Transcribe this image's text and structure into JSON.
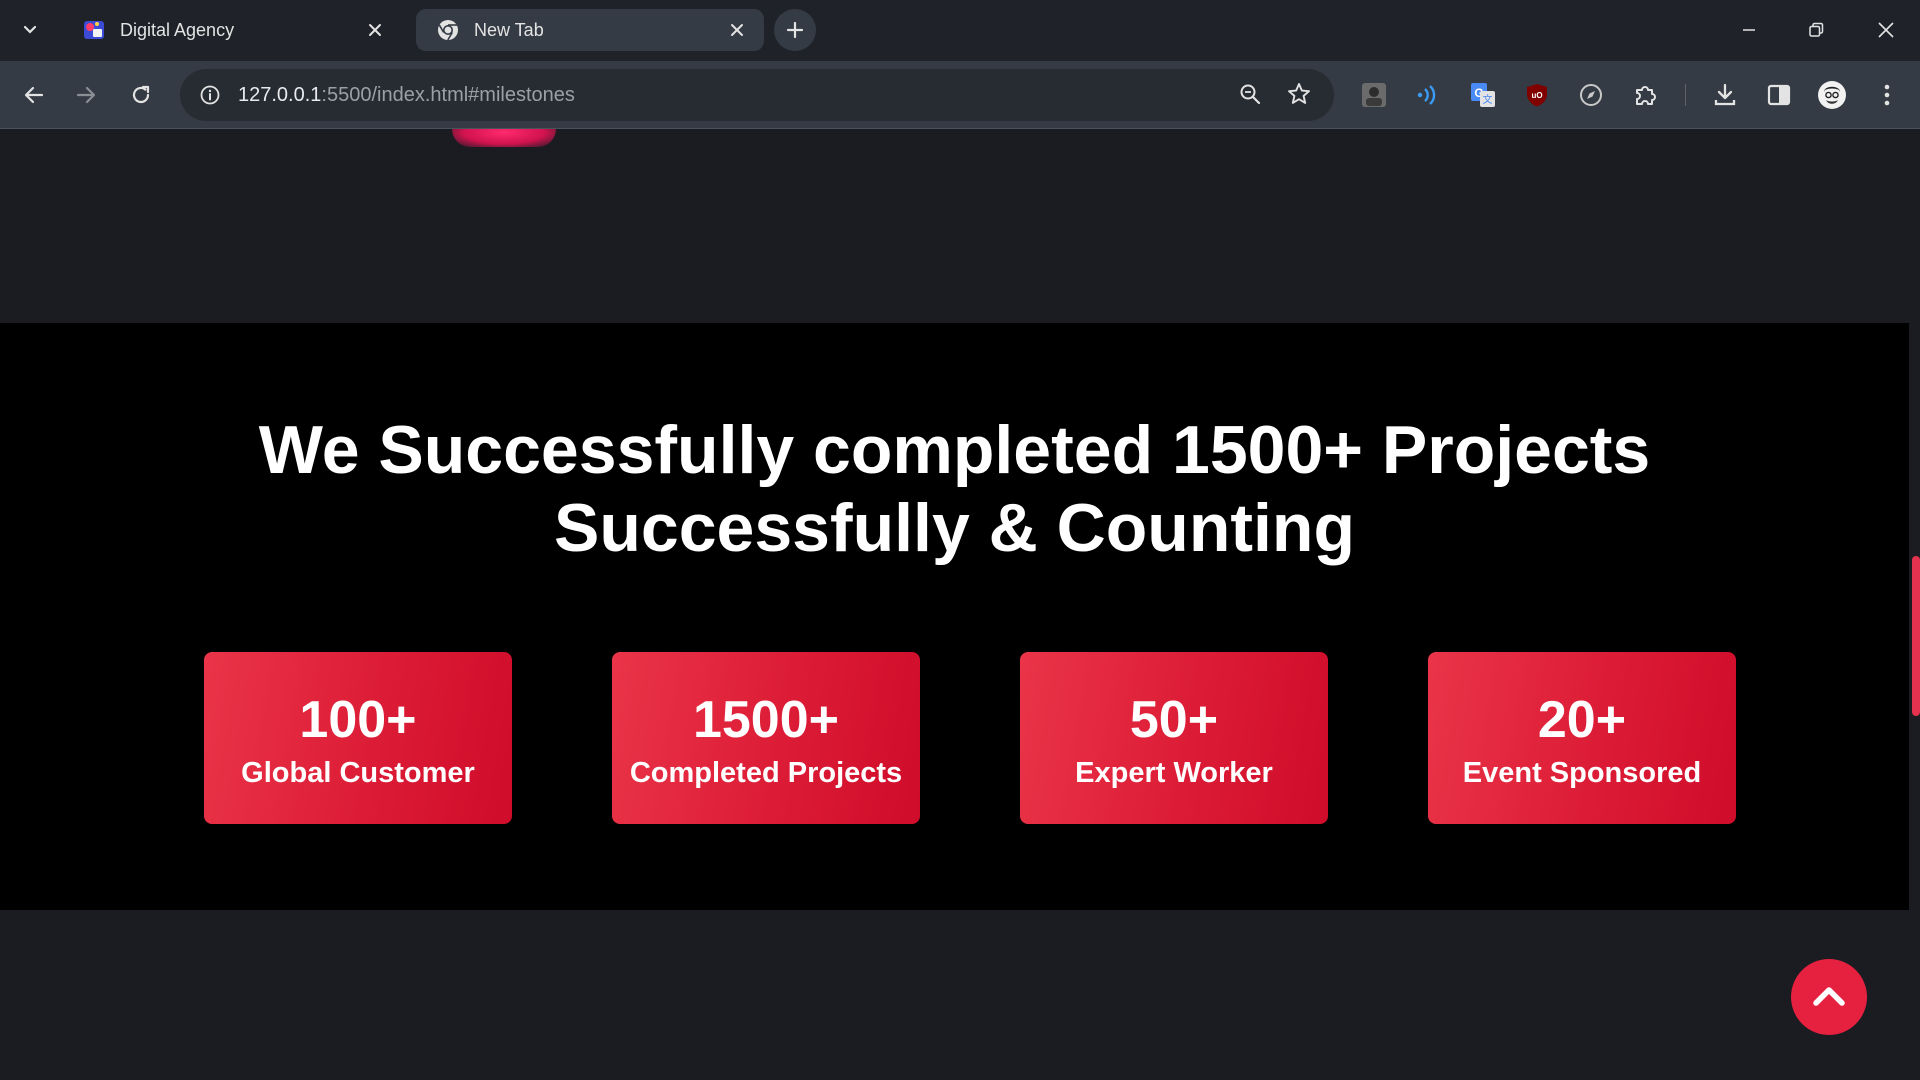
{
  "browser": {
    "tabs": [
      {
        "title": "Digital Agency",
        "active": true
      },
      {
        "title": "New Tab",
        "active": false
      }
    ],
    "address": {
      "host": "127.0.0.1",
      "rest": ":5500/index.html#milestones"
    }
  },
  "milestones": {
    "headline_line1": "We Successfully completed 1500+ Projects",
    "headline_line2": "Successfully & Counting",
    "stats": [
      {
        "number": "100+",
        "label": "Global Customer"
      },
      {
        "number": "1500+",
        "label": "Completed Projects"
      },
      {
        "number": "50+",
        "label": "Expert Worker"
      },
      {
        "number": "20+",
        "label": "Event Sponsored"
      }
    ]
  },
  "colors": {
    "accent": "#e5213f",
    "card_gradient_start": "#ea3448",
    "card_gradient_end": "#cf0c2a",
    "section_bg": "#000000",
    "page_bg": "#1a1c22"
  }
}
